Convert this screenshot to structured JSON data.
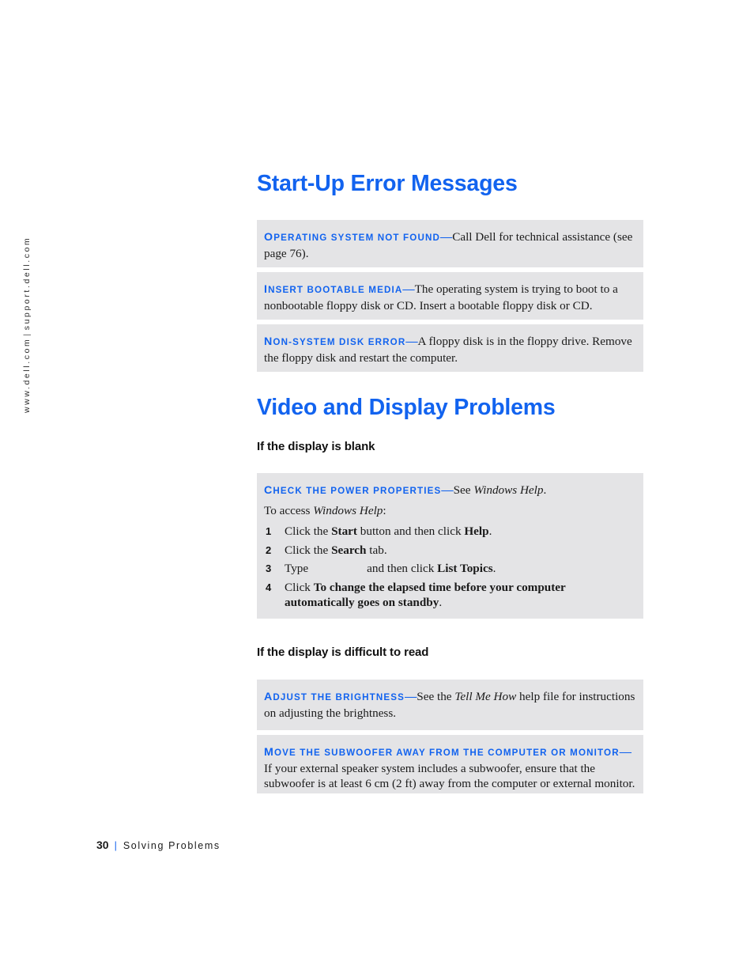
{
  "sidebar": {
    "url_left": "www.dell.com",
    "separator": "|",
    "url_right": "support.dell.com"
  },
  "colors": {
    "heading_blue": "#1263EF",
    "box_gray": "#e4e4e6",
    "body_text": "#1b1b1b"
  },
  "sections": {
    "startup": {
      "title": "Start-Up Error Messages",
      "boxes": [
        {
          "lead": "Operating system not found",
          "dash": "—",
          "body": "Call Dell for technical assistance (see page 76)."
        },
        {
          "lead": "Insert bootable media",
          "dash": "—",
          "body": "The operating system is trying to boot to a nonbootable floppy disk or CD. Insert a bootable floppy disk or CD."
        },
        {
          "lead": "Non-system disk error",
          "dash": "—",
          "body": "A floppy disk is in the floppy drive. Remove the floppy disk and restart the computer."
        }
      ]
    },
    "video": {
      "title": "Video and Display Problems",
      "sub_blank": "If the display is blank",
      "sub_difficult": "If the display is difficult to read",
      "blank_box": {
        "lead": "Check the Power Properties",
        "dash": "—",
        "body_pre": "See ",
        "body_italic": "Windows Help",
        "body_post": ".",
        "intro_pre": "To access ",
        "intro_italic": "Windows Help",
        "intro_post": ":",
        "steps": [
          {
            "num": "1",
            "pre": "Click the ",
            "bold1": "Start",
            "mid": " button and then click ",
            "bold2": "Help",
            "post": "."
          },
          {
            "num": "2",
            "pre": "Click the ",
            "bold1": "Search",
            "mid": " tab.",
            "bold2": "",
            "post": ""
          },
          {
            "num": "3",
            "pre": "Type",
            "bold1": "",
            "mid": "and then click ",
            "bold2": "List Topics",
            "post": "."
          },
          {
            "num": "4",
            "pre": "Click ",
            "bold1": "To change the elapsed time before your computer automatically goes on standby",
            "mid": "",
            "bold2": "",
            "post": "."
          }
        ]
      },
      "difficult_boxes": [
        {
          "lead": "Adjust the brightness",
          "dash": "—",
          "body_pre": "See the ",
          "body_italic": "Tell Me How",
          "body_post": " help file for instructions on adjusting the brightness."
        },
        {
          "lead": "Move the subwoofer away from the computer or monitor",
          "dash": "—",
          "body_pre": "If your external speaker system includes a subwoofer, ensure that the subwoofer is at least 6 cm (2 ft) away from the computer or external monitor.",
          "body_italic": "",
          "body_post": ""
        }
      ]
    }
  },
  "footer": {
    "page_number": "30",
    "separator": "|",
    "chapter": "Solving Problems"
  }
}
